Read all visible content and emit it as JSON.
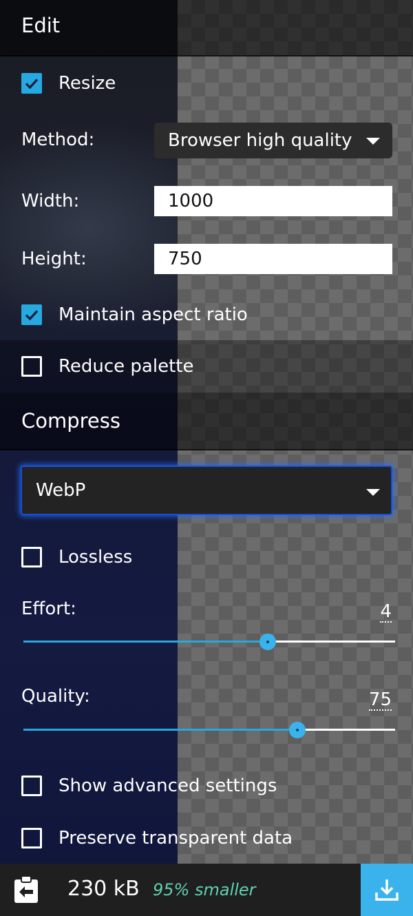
{
  "edit": {
    "title": "Edit",
    "resize_label": "Resize",
    "resize_checked": true,
    "method_label": "Method:",
    "method_value": "Browser high quality",
    "width_label": "Width:",
    "width_value": "1000",
    "height_label": "Height:",
    "height_value": "750",
    "maintain_label": "Maintain aspect ratio",
    "maintain_checked": true,
    "reduce_palette_label": "Reduce palette",
    "reduce_palette_checked": false
  },
  "compress": {
    "title": "Compress",
    "format_value": "WebP",
    "lossless_label": "Lossless",
    "lossless_checked": false,
    "effort_label": "Effort:",
    "effort_value": "4",
    "effort_fraction": 0.658,
    "quality_label": "Quality:",
    "quality_value": "75",
    "quality_fraction": 0.737,
    "advanced_label": "Show advanced settings",
    "advanced_checked": false,
    "preserve_label": "Preserve transparent data",
    "preserve_checked": false
  },
  "footer": {
    "size": "230 kB",
    "percent": "95% smaller"
  },
  "colors": {
    "accent": "#26a8e0",
    "savings": "#5fd1b0",
    "focus": "#1650d8"
  }
}
